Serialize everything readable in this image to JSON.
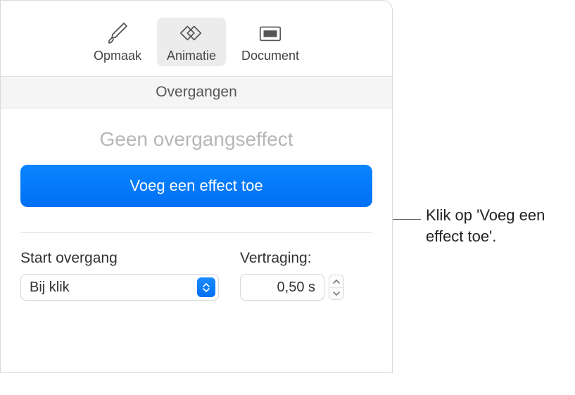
{
  "toolbar": {
    "tabs": [
      {
        "label": "Opmaak"
      },
      {
        "label": "Animatie"
      },
      {
        "label": "Document"
      }
    ]
  },
  "section": {
    "header": "Overgangen",
    "effect_title": "Geen overgangseffect",
    "add_effect_label": "Voeg een effect toe"
  },
  "controls": {
    "start_label": "Start overgang",
    "start_value": "Bij klik",
    "delay_label": "Vertraging:",
    "delay_value": "0,50 s"
  },
  "callout": {
    "text": "Klik op 'Voeg een effect toe'."
  }
}
